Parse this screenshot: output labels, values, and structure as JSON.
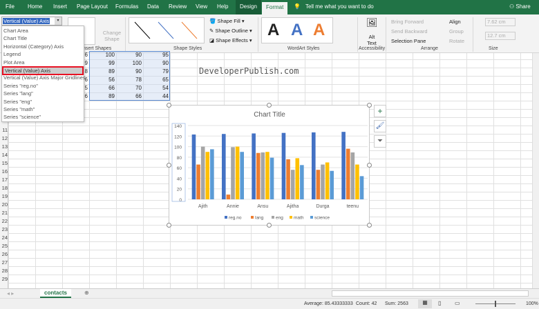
{
  "tabs": [
    "File",
    "Home",
    "Insert",
    "Page Layout",
    "Formulas",
    "Data",
    "Review",
    "View",
    "Help",
    "Design",
    "Format"
  ],
  "tell_me": "Tell me what you want to do",
  "share": "Share",
  "ribbon": {
    "insert_shapes": "Insert Shapes",
    "change_shape": "Change Shape",
    "shape_styles": "Shape Styles",
    "shape_fill": "Shape Fill",
    "shape_outline": "Shape Outline",
    "shape_effects": "Shape Effects",
    "wordart_styles": "WordArt Styles",
    "alt_text": "Alt Text",
    "accessibility": "Accessibility",
    "bring_forward": "Bring Forward",
    "send_backward": "Send Backward",
    "selection_pane": "Selection Pane",
    "align": "Align",
    "group": "Group",
    "rotate": "Rotate",
    "arrange": "Arrange",
    "height": "7.62 cm",
    "width": "12.7 cm",
    "size": "Size"
  },
  "name_box": "Vertical (Value) Axis",
  "dropdown": [
    "Chart Area",
    "Chart Title",
    "Horizontal (Category) Axis",
    "Legend",
    "Plot Area",
    "Vertical (Value) Axis",
    "Vertical (Value) Axis Major Gridlines",
    "Series \"reg.no\"",
    "Series \"lang\"",
    "Series \"eng\"",
    "Series \"math\"",
    "Series \"science\""
  ],
  "cells": {
    "col_a": [
      "6",
      "9",
      "8",
      "6",
      "5",
      "6"
    ],
    "eng": [
      "100",
      "99",
      "89",
      "56",
      "66",
      "89"
    ],
    "math": [
      "90",
      "100",
      "90",
      "78",
      "70",
      "66"
    ],
    "science": [
      "95",
      "90",
      "79",
      "65",
      "54",
      "44"
    ]
  },
  "watermark": "DeveloperPublish.com",
  "rows": [
    "11",
    "12",
    "13",
    "14",
    "15",
    "16",
    "17",
    "18",
    "19",
    "20",
    "21",
    "22",
    "23",
    "24",
    "25",
    "26",
    "27",
    "28",
    "29"
  ],
  "chart_data": {
    "type": "bar",
    "title": "Chart Title",
    "categories": [
      "Ajith",
      "Annie",
      "Ansu",
      "Ajitha",
      "Durga",
      "teenu"
    ],
    "ylim": [
      0,
      140
    ],
    "yticks": [
      "0",
      "20",
      "40",
      "60",
      "80",
      "100",
      "120",
      "140"
    ],
    "series": [
      {
        "name": "reg.no",
        "color": "#4472c4",
        "values": [
          123,
          124,
          125,
          126,
          127,
          128
        ]
      },
      {
        "name": "lang",
        "color": "#ed7d31",
        "values": [
          66,
          9,
          88,
          76,
          56,
          96
        ]
      },
      {
        "name": "eng",
        "color": "#a5a5a5",
        "values": [
          100,
          99,
          89,
          56,
          66,
          89
        ]
      },
      {
        "name": "math",
        "color": "#ffc000",
        "values": [
          90,
          100,
          90,
          78,
          70,
          66
        ]
      },
      {
        "name": "science",
        "color": "#5b9bd5",
        "values": [
          95,
          90,
          79,
          65,
          54,
          44
        ]
      }
    ],
    "legend": "bottom"
  },
  "sheet_tab": "contacts",
  "status": {
    "average": "Average: 85.43333333",
    "count": "Count: 42",
    "sum": "Sum: 2563",
    "zoom": "100%"
  }
}
